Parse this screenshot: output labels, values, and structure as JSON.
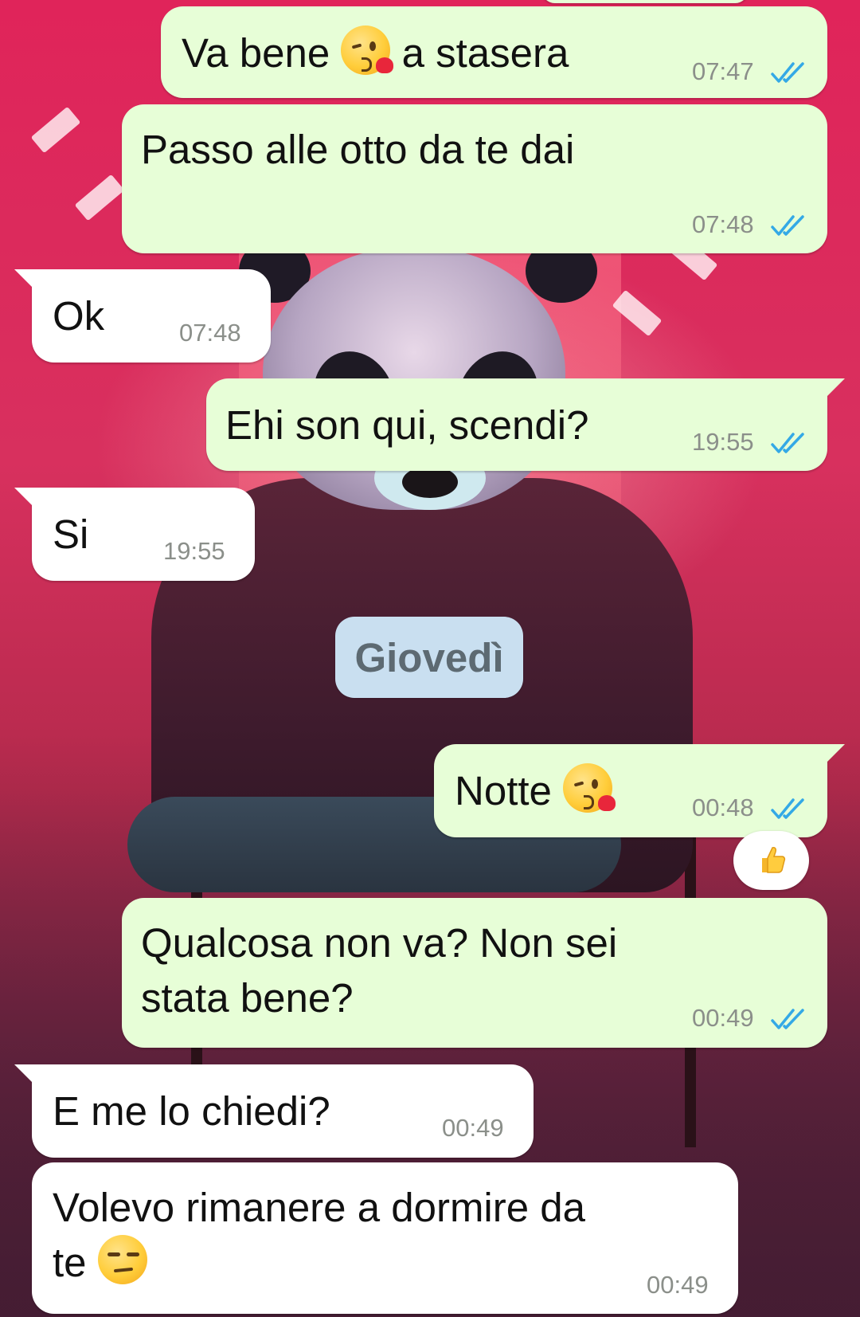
{
  "conversation": {
    "messages": [
      {
        "direction": "out",
        "text": "Va bene",
        "emoji": "kissing-face-with-heart-emoji",
        "text_after": "a stasera",
        "time": "07:47",
        "status": "read"
      },
      {
        "direction": "out",
        "text": "Passo alle otto da te dai",
        "time": "07:48",
        "status": "read"
      },
      {
        "direction": "in",
        "text": "Ok",
        "time": "07:48"
      },
      {
        "direction": "out",
        "text": "Ehi son qui, scendi?",
        "time": "19:55",
        "status": "read"
      },
      {
        "direction": "in",
        "text": "Si",
        "time": "19:55"
      },
      {
        "direction": "out",
        "text": "Notte",
        "emoji": "kissing-face-with-heart-emoji",
        "time": "00:48",
        "status": "read",
        "reaction": "thumbs-up-emoji"
      },
      {
        "direction": "out",
        "text_line1": "Qualcosa non va? Non sei",
        "text_line2": "stata bene?",
        "time": "00:49",
        "status": "read"
      },
      {
        "direction": "in",
        "text": "E me lo chiedi?",
        "time": "00:49"
      },
      {
        "direction": "in",
        "text_line1": "Volevo rimanere a dormire da",
        "text_line2": "te",
        "emoji": "unamused-face-emoji",
        "time": "00:49"
      }
    ],
    "date_separator": "Giovedì"
  },
  "colors": {
    "outgoing_bubble": "#e7fed7",
    "incoming_bubble": "#ffffff",
    "read_ticks": "#34a9e6",
    "date_chip": "#c9dff0"
  }
}
